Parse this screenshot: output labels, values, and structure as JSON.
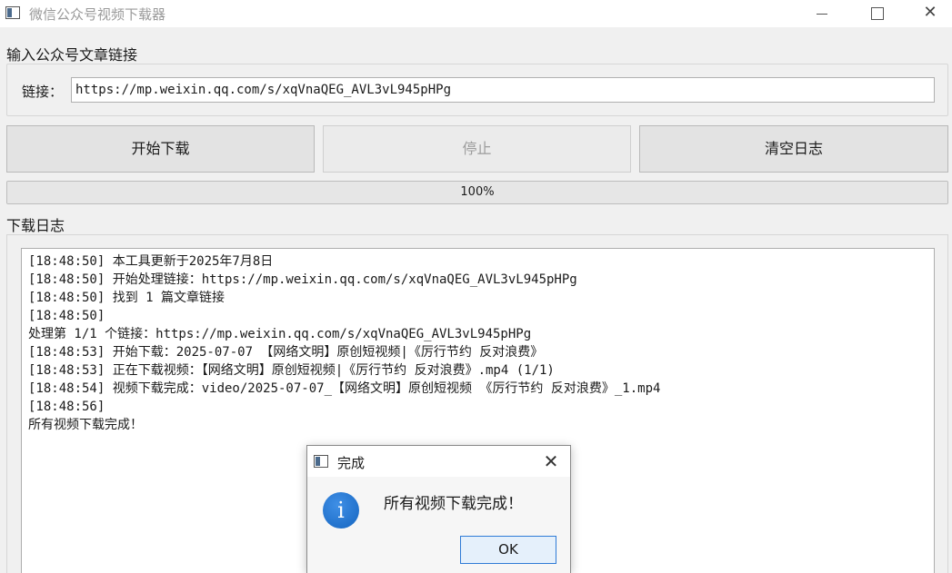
{
  "window": {
    "title": "微信公众号视频下载器",
    "close_glyph": "✕"
  },
  "link_section": {
    "title": "输入公众号文章链接",
    "label": "链接：",
    "value": "https://mp.weixin.qq.com/s/xqVnaQEG_AVL3vL945pHPg"
  },
  "buttons": {
    "start": "开始下载",
    "stop": "停止",
    "clear": "清空日志"
  },
  "progress": {
    "value": 100,
    "text": "100%"
  },
  "log_section": {
    "title": "下载日志",
    "lines": [
      "[18:48:50] 本工具更新于2025年7月8日",
      "[18:48:50] 开始处理链接：https://mp.weixin.qq.com/s/xqVnaQEG_AVL3vL945pHPg",
      "[18:48:50] 找到 1 篇文章链接",
      "[18:48:50]",
      "处理第 1/1 个链接：https://mp.weixin.qq.com/s/xqVnaQEG_AVL3vL945pHPg",
      "[18:48:53] 开始下载：2025-07-07 【网络文明】原创短视频|《厉行节约 反对浪费》",
      "[18:48:53] 正在下载视频：【网络文明】原创短视频|《厉行节约 反对浪费》.mp4 (1/1)",
      "[18:48:54] 视频下载完成：video/2025-07-07_【网络文明】原创短视频 《厉行节约 反对浪费》_1.mp4",
      "[18:48:56]",
      "所有视频下载完成！"
    ]
  },
  "dialog": {
    "title": "完成",
    "close_glyph": "✕",
    "icon_glyph": "i",
    "message": "所有视频下载完成！",
    "ok_label": "OK"
  }
}
